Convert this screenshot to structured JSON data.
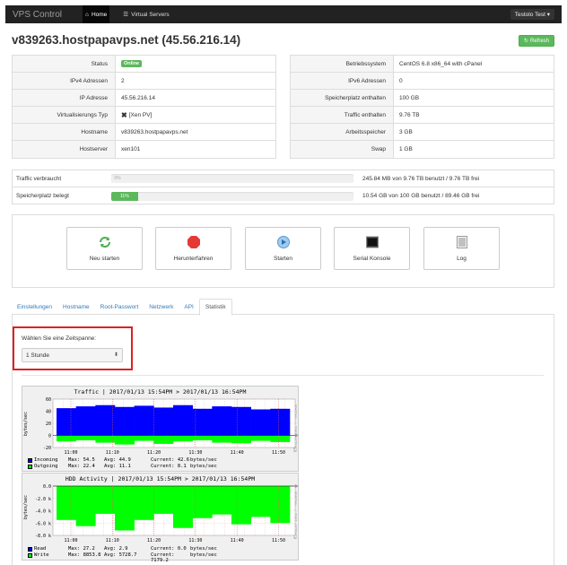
{
  "nav": {
    "brand": "VPS Control",
    "home": "Home",
    "servers": "Virtual Servers",
    "user": "Testolo Test ▾"
  },
  "page": {
    "title": "v839263.hostpapavps.net (45.56.216.14)",
    "refresh": "Refresh"
  },
  "left_table": [
    {
      "key": "Status",
      "value": "Online"
    },
    {
      "key": "IPv4 Adressen",
      "value": "2"
    },
    {
      "key": "IP Adresse",
      "value": "45.56.216.14"
    },
    {
      "key": "Virtualisierungs Typ",
      "value": "[Xen PV]"
    },
    {
      "key": "Hostname",
      "value": "v839263.hostpapavps.net"
    },
    {
      "key": "Hostserver",
      "value": "xen101"
    }
  ],
  "right_table": [
    {
      "key": "Betriebssystem",
      "value": "CentOS 6.8 x86_64 with cPanel"
    },
    {
      "key": "IPv6 Adressen",
      "value": "0"
    },
    {
      "key": "Speicherplatz enthalten",
      "value": "100 GB"
    },
    {
      "key": "Traffic enthalten",
      "value": "9.76 TB"
    },
    {
      "key": "Arbeitsspeicher",
      "value": "3 GB"
    },
    {
      "key": "Swap",
      "value": "1 GB"
    }
  ],
  "usage": {
    "traffic_label": "Traffic verbraucht",
    "traffic_percent_text": "0%",
    "traffic_fraction": 0.0,
    "traffic_text": "245.84 MB von 9.76 TB benutzt / 9.76 TB frei",
    "disk_label": "Speicherplatz belegt",
    "disk_percent_text": "11%",
    "disk_fraction": 0.11,
    "disk_text": "10.54 GB von 100 GB benutzt / 89.46 GB frei"
  },
  "actions": [
    {
      "label": "Neu starten",
      "icon": "restart-icon"
    },
    {
      "label": "Herunterfahren",
      "icon": "stop-icon"
    },
    {
      "label": "Starten",
      "icon": "play-icon"
    },
    {
      "label": "Serial Konsole",
      "icon": "terminal-icon"
    },
    {
      "label": "Log",
      "icon": "document-icon"
    }
  ],
  "tabs": [
    "Einstellungen",
    "Hostname",
    "Root-Passwort",
    "Netzwerk",
    "API",
    "Statistik"
  ],
  "stats": {
    "period_label": "Wählen Sie eine Zeitspanne:",
    "period_value": "1 Stunde"
  },
  "colors": {
    "incoming": "#0000ff",
    "outgoing": "#00ff00",
    "read": "#0000ff",
    "write": "#00ff00",
    "success": "#5cb85c",
    "highlight": "#e02020"
  },
  "chart_data": [
    {
      "type": "area",
      "title": "Traffic | 2017/01/13 15:54PM > 2017/01/13 16:54PM",
      "ylabel": "bytes/sec",
      "x": [
        "11:00",
        "11:10",
        "11:20",
        "11:30",
        "11:40",
        "11:50"
      ],
      "yticks": [
        "60",
        "40",
        "20",
        "0",
        "-20"
      ],
      "ylim": [
        -20,
        60
      ],
      "series": [
        {
          "name": "Incoming",
          "values": [
            45,
            48,
            50,
            47,
            49,
            46,
            50,
            44,
            48,
            47,
            43,
            44
          ]
        },
        {
          "name": "Outgoing",
          "values": [
            -10,
            -8,
            -12,
            -15,
            -9,
            -14,
            -10,
            -8,
            -12,
            -13,
            -9,
            -11
          ]
        }
      ],
      "legend": [
        {
          "name": "Incoming",
          "max_label": "Max:",
          "max": "54.5",
          "avg_label": "Avg:",
          "avg": "44.9",
          "cur_label": "Current:",
          "cur": "42.6",
          "unit": "bytes/sec"
        },
        {
          "name": "Outgoing",
          "max_label": "Max:",
          "max": "22.4",
          "avg_label": "Avg:",
          "avg": "11.1",
          "cur_label": "Current:",
          "cur": "8.1",
          "unit": "bytes/sec"
        }
      ]
    },
    {
      "type": "area",
      "title": "HDD Activity | 2017/01/13 15:54PM > 2017/01/13 16:54PM",
      "ylabel": "bytes/sec",
      "x": [
        "11:00",
        "11:10",
        "11:20",
        "11:30",
        "11:40",
        "11:50"
      ],
      "yticks": [
        "0.0",
        "-2.0 k",
        "-4.0 k",
        "-6.0 k",
        "-8.0 k"
      ],
      "ylim": [
        -8,
        0
      ],
      "series": [
        {
          "name": "Read",
          "values": [
            0,
            0,
            0,
            0,
            0,
            0,
            0,
            0,
            0,
            0,
            0,
            0
          ]
        },
        {
          "name": "Write",
          "values": [
            -5.5,
            -6.5,
            -4.5,
            -7.2,
            -5.5,
            -4.5,
            -6.8,
            -5.2,
            -4.6,
            -6.2,
            -5.0,
            -6.0
          ]
        }
      ],
      "legend": [
        {
          "name": "Read",
          "max_label": "Max:",
          "max": "27.2",
          "avg_label": "Avg:",
          "avg": "2.9",
          "cur_label": "Current:",
          "cur": "0.0",
          "unit": "bytes/sec"
        },
        {
          "name": "Write",
          "max_label": "Max:",
          "max": "8853.8",
          "avg_label": "Avg:",
          "avg": "5728.7",
          "cur_label": "Current:",
          "cur": "7179.2",
          "unit": "bytes/sec"
        }
      ]
    }
  ]
}
